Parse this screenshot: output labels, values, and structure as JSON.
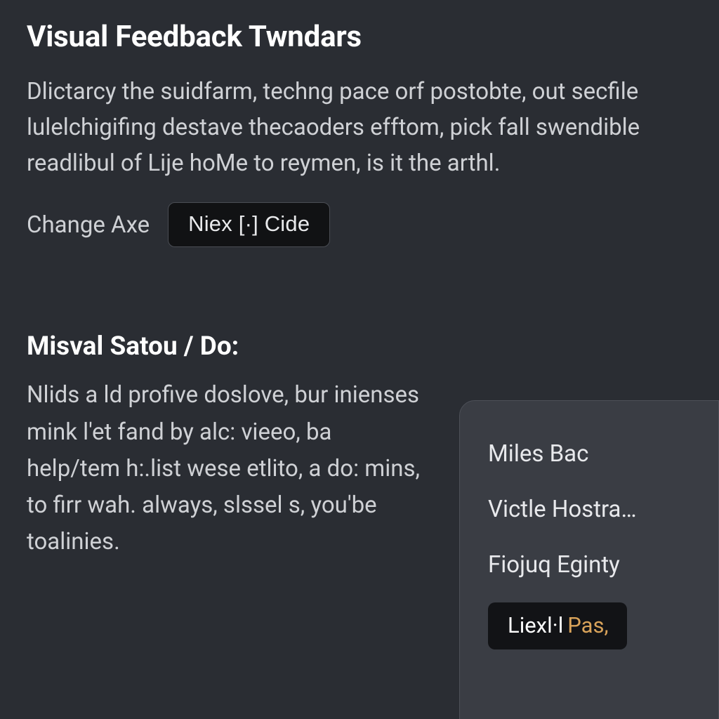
{
  "section1": {
    "title": "Visual Feedback Twndars",
    "body": "Dlictarcy the suidfarm, techng pace orf postobte, out secfile lulelchigifing destave thecaoders efftom, pick fall swendible readlibul of Lije hoMe to reymen, is it the arthl.",
    "action_label": "Change Axe",
    "button_label": "Niex [·] Cide"
  },
  "section2": {
    "title": "Misval Satou / Do:",
    "body": "Nlids a ld profive doslove, bur inienses mink l'et fand by alc: vieeo, ba help/tem h:.list wese etlito, a do: mins, to firr wah. always, slssel s, you'be toalinies."
  },
  "panel": {
    "items": [
      "Miles Bac",
      "Victle Hostra…",
      "Fiojuq Eginty"
    ],
    "button_prefix": "Liex ",
    "button_mid": "l·l ",
    "button_suffix": "Pas,"
  }
}
